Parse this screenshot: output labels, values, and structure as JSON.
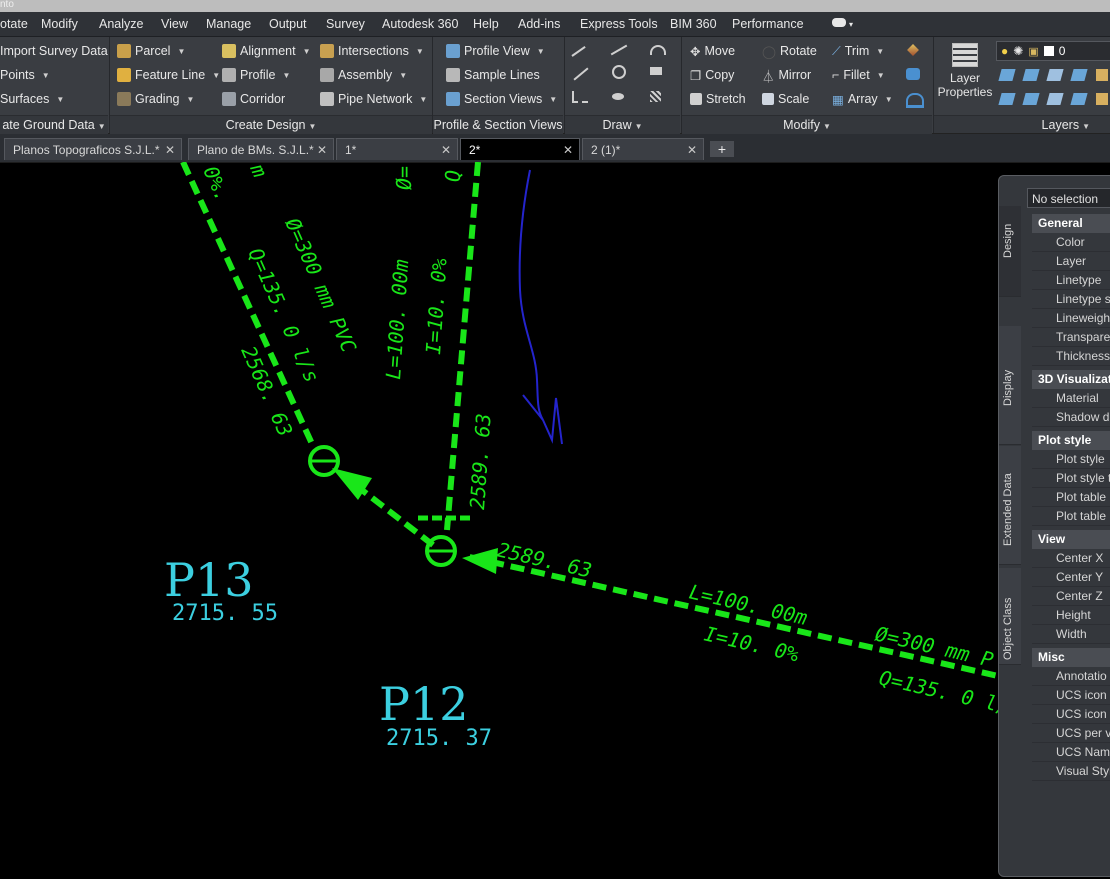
{
  "window": {
    "title_fragment": "nto"
  },
  "menu": [
    "otate",
    "Modify",
    "Analyze",
    "View",
    "Manage",
    "Output",
    "Survey",
    "Autodesk 360",
    "Help",
    "Add-ins",
    "Express Tools",
    "BIM 360",
    "Performance"
  ],
  "ribbon": {
    "create_ground": {
      "items": [
        "Import Survey Data",
        "Points",
        "Surfaces"
      ],
      "title": "ate Ground Data"
    },
    "create_design": {
      "col1": [
        "Parcel",
        "Feature Line",
        "Grading"
      ],
      "col2": [
        "Alignment",
        "Profile",
        "Corridor"
      ],
      "col3": [
        "Intersections",
        "Assembly",
        "Pipe Network"
      ],
      "title": "Create Design"
    },
    "profile_section": {
      "items": [
        "Profile View",
        "Sample Lines",
        "Section Views"
      ],
      "title": "Profile & Section Views"
    },
    "draw": {
      "title": "Draw"
    },
    "modify": {
      "col1": [
        "Move",
        "Copy",
        "Stretch"
      ],
      "col2": [
        "Rotate",
        "Mirror",
        "Scale"
      ],
      "col3": [
        "Trim",
        "Fillet",
        "Array"
      ],
      "title": "Modify"
    },
    "layers": {
      "props_line1": "Layer",
      "props_line2": "Properties",
      "layer_value": "0",
      "title": "Layers"
    }
  },
  "tabs": [
    {
      "label": "Planos Topograficos  S.J.L.*"
    },
    {
      "label": "Plano de BMs. S.J.L.*"
    },
    {
      "label": "1*"
    },
    {
      "label": "2*"
    },
    {
      "label": "2 (1)*"
    }
  ],
  "drawing": {
    "manholes": [
      {
        "name": "P13",
        "elevation": "2715. 55"
      },
      {
        "name": "P12",
        "elevation": "2715. 37"
      }
    ],
    "pipe_labels": {
      "left_top_a": "0%.",
      "left_top_b": "m",
      "left_diameter": "Ø=300 mm PVC",
      "left_flow": "Q=135. 0 l/s",
      "left_invert": "2568. 63",
      "mid_top_a": "Ø=",
      "mid_top_b": "Q",
      "mid_length": "L=100. 00m",
      "mid_slope": "I=10. 0%",
      "mid_invert": "2589. 63",
      "right_invert": "2589. 63",
      "right_length": "L=100. 00m",
      "right_slope": "I=10. 0%",
      "right_diameter": "Ø=300 mm P",
      "right_flow": "Q=135. 0 l/"
    },
    "colors": {
      "pipe": "#19e619",
      "label": "#3ccfe0",
      "sketch": "#2222cc"
    }
  },
  "properties": {
    "selection": "No selection",
    "vtabs": [
      "Design",
      "Display",
      "Extended Data",
      "Object Class"
    ],
    "sections": [
      {
        "title": "General",
        "items": [
          "Color",
          "Layer",
          "Linetype",
          "Linetype s",
          "Lineweigh",
          "Transparen",
          "Thickness"
        ]
      },
      {
        "title": "3D Visualizat",
        "items": [
          "Material",
          "Shadow di"
        ]
      },
      {
        "title": "Plot style",
        "items": [
          "Plot style",
          "Plot style t",
          "Plot table",
          "Plot table"
        ]
      },
      {
        "title": "View",
        "items": [
          "Center X",
          "Center Y",
          "Center Z",
          "Height",
          "Width"
        ]
      },
      {
        "title": "Misc",
        "items": [
          "Annotatio",
          "UCS icon O",
          "UCS icon",
          "UCS per vi",
          "UCS Name",
          "Visual Styl"
        ]
      }
    ]
  }
}
